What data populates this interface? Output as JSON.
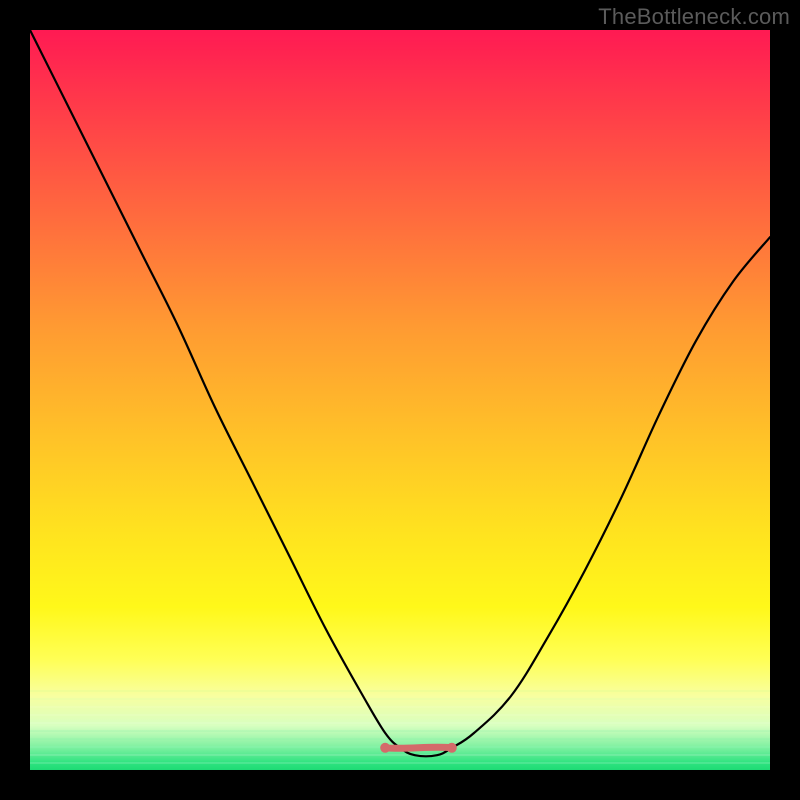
{
  "attribution": "TheBottleneck.com",
  "colors": {
    "page_bg": "#000000",
    "attribution_text": "#5b5b5b",
    "curve_stroke": "#000000",
    "valley_marker": "#d46a6a",
    "gradient_top": "#ff1a53",
    "gradient_bottom": "#1edb75"
  },
  "chart_data": {
    "type": "line",
    "title": "",
    "xlabel": "",
    "ylabel": "",
    "xlim": [
      0,
      100
    ],
    "ylim": [
      0,
      100
    ],
    "grid": false,
    "legend": false,
    "note": "V-shaped bottleneck curve; y ≈ percent bottleneck, x ≈ component-match axis. Values estimated from pixel positions; axes are unlabeled.",
    "series": [
      {
        "name": "bottleneck-curve",
        "x": [
          0,
          5,
          10,
          15,
          20,
          25,
          30,
          35,
          40,
          45,
          48,
          50,
          52,
          55,
          57,
          60,
          65,
          70,
          75,
          80,
          85,
          90,
          95,
          100
        ],
        "y": [
          100,
          90,
          80,
          70,
          60,
          49,
          39,
          29,
          19,
          10,
          5,
          3,
          2,
          2,
          3,
          5,
          10,
          18,
          27,
          37,
          48,
          58,
          66,
          72
        ]
      }
    ],
    "valley_region": {
      "x_start": 48,
      "x_end": 57,
      "y_level": 3,
      "endpoint_radius": 1.2
    },
    "background": {
      "description": "Vertical heat gradient from red (top, high bottleneck) through orange/yellow to green (bottom, low bottleneck)",
      "stops": [
        {
          "pos": 0.0,
          "color": "#ff1a53"
        },
        {
          "pos": 0.25,
          "color": "#ff6a3e"
        },
        {
          "pos": 0.55,
          "color": "#ffc228"
        },
        {
          "pos": 0.78,
          "color": "#fff81a"
        },
        {
          "pos": 0.94,
          "color": "#d8ffc0"
        },
        {
          "pos": 1.0,
          "color": "#1edb75"
        }
      ]
    }
  }
}
